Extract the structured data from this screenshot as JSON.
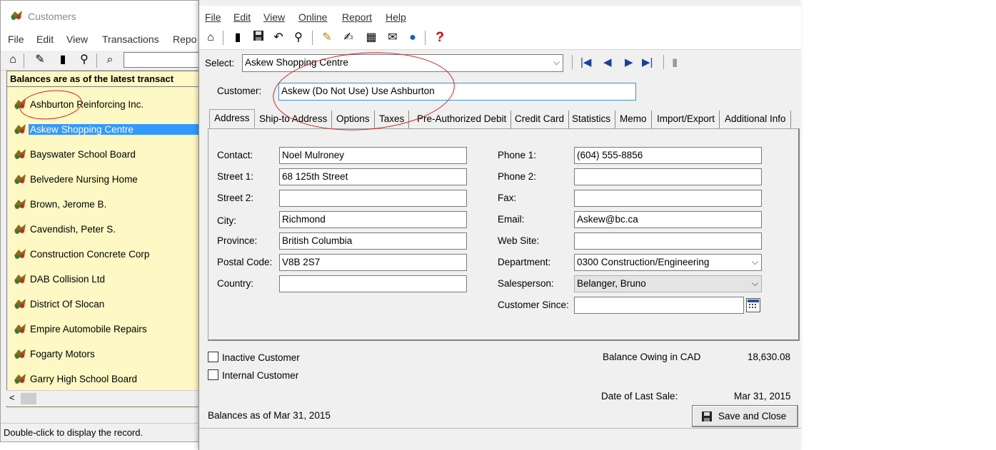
{
  "list_window": {
    "title": "Customers",
    "menu": [
      "File",
      "Edit",
      "View",
      "Transactions",
      "Repo"
    ],
    "list_header": "Balances are as of the latest transact",
    "customers": [
      "Ashburton Reinforcing Inc.",
      "Askew Shopping Centre",
      "Bayswater School Board",
      "Belvedere Nursing Home",
      "Brown, Jerome B.",
      "Cavendish, Peter S.",
      "Construction Concrete Corp",
      "DAB Collision Ltd",
      "District Of Slocan",
      "Empire Automobile Repairs",
      "Fogarty Motors",
      "Garry High School Board"
    ],
    "selected_index": 1,
    "scroll_left_glyph": "<",
    "status_text": "Double-click to display the record."
  },
  "record_window": {
    "menu": [
      "File",
      "Edit",
      "View",
      "Online",
      "Report",
      "Help"
    ],
    "select_label": "Select:",
    "select_value": "Askew Shopping Centre",
    "customer_label": "Customer:",
    "customer_value": "Askew (Do Not Use) Use Ashburton",
    "tabs": [
      "Address",
      "Ship-to Address",
      "Options",
      "Taxes",
      "Pre-Authorized Debit",
      "Credit Card",
      "Statistics",
      "Memo",
      "Import/Export",
      "Additional Info"
    ],
    "active_tab": 0,
    "address": {
      "contact_label": "Contact:",
      "contact": "Noel Mulroney",
      "street1_label": "Street 1:",
      "street1": "68 125th Street",
      "street2_label": "Street 2:",
      "street2": "",
      "city_label": "City:",
      "city": "Richmond",
      "province_label": "Province:",
      "province": "British Columbia",
      "postal_label": "Postal Code:",
      "postal": "V8B 2S7",
      "country_label": "Country:",
      "country": "",
      "phone1_label": "Phone 1:",
      "phone1": "(604) 555-8856",
      "phone2_label": "Phone 2:",
      "phone2": "",
      "fax_label": "Fax:",
      "fax": "",
      "email_label": "Email:",
      "email": "Askew@bc.ca",
      "website_label": "Web Site:",
      "website": "",
      "department_label": "Department:",
      "department": "0300 Construction/Engineering",
      "salesperson_label": "Salesperson:",
      "salesperson": "Belanger, Bruno",
      "since_label": "Customer Since:",
      "since": ""
    },
    "inactive_label": "Inactive Customer",
    "internal_label": "Internal Customer",
    "balance_label": "Balance Owing in CAD",
    "balance_value": "18,630.08",
    "last_sale_label": "Date of Last Sale:",
    "last_sale_value": "Mar 31, 2015",
    "balances_asof": "Balances as of Mar 31, 2015",
    "save_close_label": "Save and Close"
  },
  "colors": {
    "list_background": "#fdf8c4",
    "selection": "#3399ff",
    "annotation": "#d42020",
    "help_icon": "#d40000"
  }
}
